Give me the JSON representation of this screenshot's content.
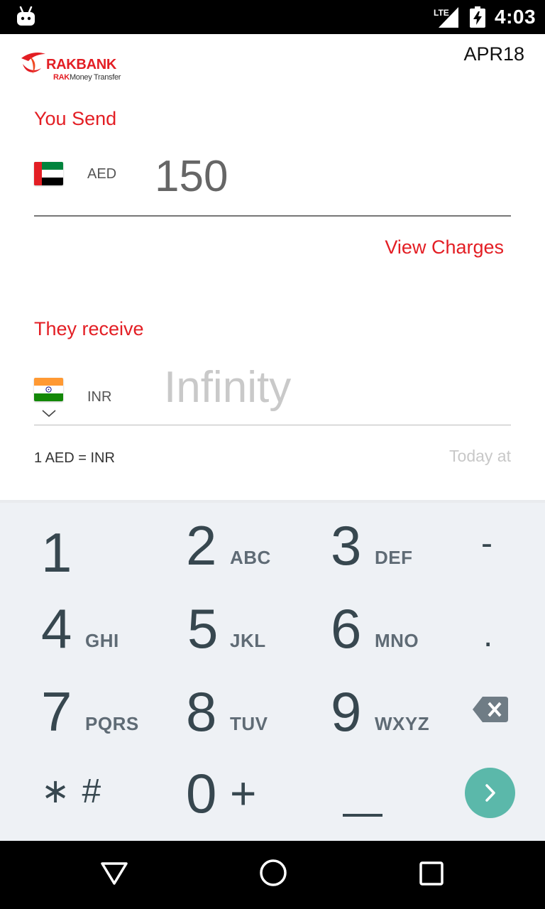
{
  "status_bar": {
    "network": "LTE",
    "time": "4:03"
  },
  "header": {
    "brand_name": "RAKBANK",
    "brand_sub_bold": "RAK",
    "brand_sub": "Money Transfer",
    "version_label": "APR18"
  },
  "send": {
    "label": "You Send",
    "currency": "AED",
    "amount": "150",
    "flag_icon": "uae-flag-icon"
  },
  "view_charges": "View Charges",
  "receive": {
    "label": "They receive",
    "currency": "INR",
    "amount": "Infinity",
    "flag_icon": "india-flag-icon"
  },
  "rate": {
    "text": "1 AED = INR",
    "updated": "Today at"
  },
  "keypad": {
    "keys": [
      {
        "num": "1",
        "letters": ""
      },
      {
        "num": "2",
        "letters": "ABC"
      },
      {
        "num": "3",
        "letters": "DEF"
      },
      {
        "num": "4",
        "letters": "GHI"
      },
      {
        "num": "5",
        "letters": "JKL"
      },
      {
        "num": "6",
        "letters": "MNO"
      },
      {
        "num": "7",
        "letters": "PQRS"
      },
      {
        "num": "8",
        "letters": "TUV"
      },
      {
        "num": "9",
        "letters": "WXYZ"
      },
      {
        "num": "0",
        "letters": "+"
      }
    ],
    "minus": "-",
    "dot": ".",
    "star_hash": "∗ #",
    "backspace_icon": "backspace-icon",
    "go_icon": "chevron-right-icon"
  },
  "colors": {
    "brand_red": "#e31e24",
    "keypad_bg": "#eef1f5",
    "key_text": "#37474f",
    "go_button": "#5bb8aa"
  }
}
